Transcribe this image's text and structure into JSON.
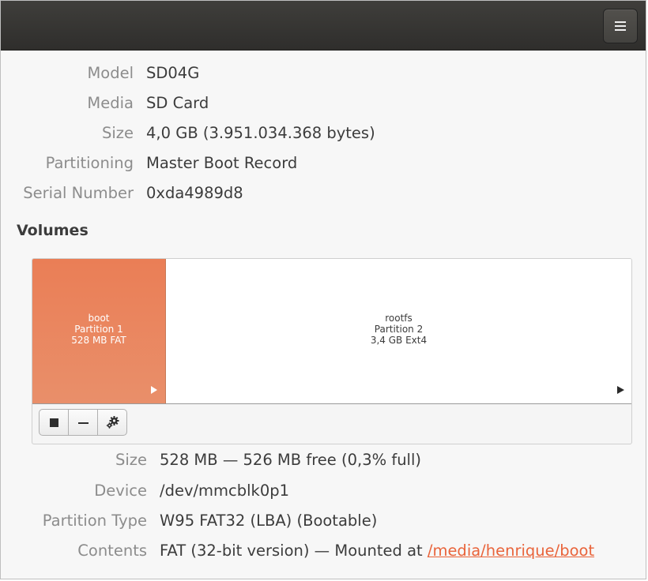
{
  "menu": {
    "icon": "hamburger-menu-icon"
  },
  "drive": {
    "model_label": "Model",
    "model_value": "SD04G",
    "media_label": "Media",
    "media_value": "SD Card",
    "size_label": "Size",
    "size_value": "4,0 GB (3.951.034.368 bytes)",
    "partitioning_label": "Partitioning",
    "partitioning_value": "Master Boot Record",
    "serial_label": "Serial Number",
    "serial_value": "0xda4989d8"
  },
  "volumes": {
    "title": "Volumes",
    "partitions": [
      {
        "name": "boot",
        "number": "Partition 1",
        "info": "528 MB FAT",
        "color": "#e9835c"
      },
      {
        "name": "rootfs",
        "number": "Partition 2",
        "info": "3,4 GB Ext4",
        "color": "#ffffff"
      }
    ],
    "toolbar": {
      "stop_icon": "stop-icon",
      "remove_icon": "minus-icon",
      "settings_icon": "gears-icon"
    }
  },
  "partition": {
    "size_label": "Size",
    "size_value": "528 MB — 526 MB free (0,3% full)",
    "device_label": "Device",
    "device_value": "/dev/mmcblk0p1",
    "type_label": "Partition Type",
    "type_value": "W95 FAT32 (LBA) (Bootable)",
    "contents_label": "Contents",
    "contents_prefix": "FAT (32-bit version) — Mounted at",
    "contents_link": "/media/henrique/boot"
  },
  "colors": {
    "accent": "#e9643b",
    "selected_partition": "#e9835c",
    "titlebar": "#363533"
  }
}
